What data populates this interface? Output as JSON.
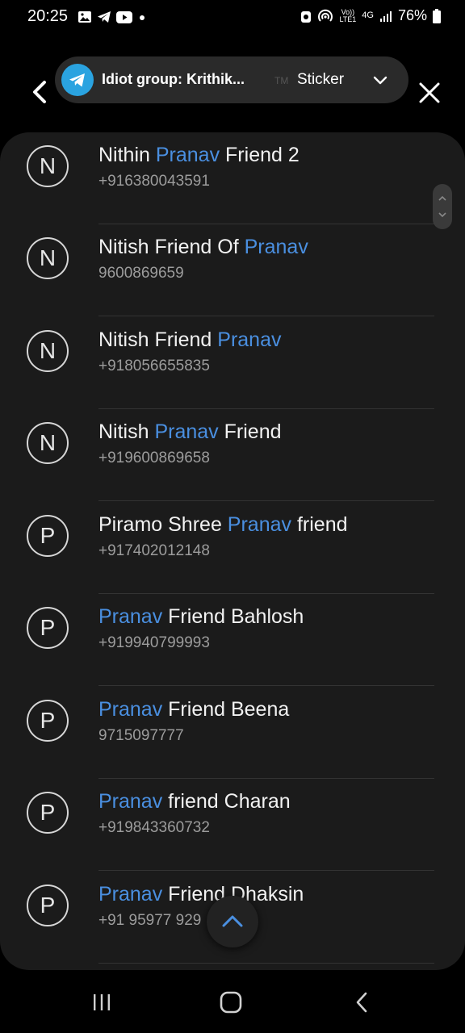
{
  "status_bar": {
    "time": "20:25",
    "battery": "76%",
    "volte": [
      "Vo))",
      "LTE1"
    ],
    "network": "4G",
    "left_icons": [
      "gallery-icon",
      "telegram-icon",
      "youtube-icon",
      "dot-icon"
    ],
    "right_icons": [
      "nfc-icon",
      "hotspot-icon",
      "signal-icon",
      "battery-icon"
    ]
  },
  "header": {
    "chat_title": "Idiot group: Krithik...",
    "tm_label": "TM",
    "sticker_label": "Sticker",
    "accent": "#2aa3e0"
  },
  "contacts": [
    {
      "initial": "N",
      "pre": "Nithin ",
      "hl": "Pranav",
      "post": " Friend 2",
      "phone": "+916380043591"
    },
    {
      "initial": "N",
      "pre": "Nitish Friend Of ",
      "hl": "Pranav",
      "post": "",
      "phone": "9600869659"
    },
    {
      "initial": "N",
      "pre": "Nitish Friend ",
      "hl": "Pranav",
      "post": "",
      "phone": "+918056655835"
    },
    {
      "initial": "N",
      "pre": "Nitish ",
      "hl": "Pranav",
      "post": " Friend",
      "phone": "+919600869658"
    },
    {
      "initial": "P",
      "pre": "Piramo Shree ",
      "hl": "Pranav",
      "post": " friend",
      "phone": "+917402012148"
    },
    {
      "initial": "P",
      "pre": "",
      "hl": "Pranav",
      "post": " Friend Bahlosh",
      "phone": "+919940799993"
    },
    {
      "initial": "P",
      "pre": "",
      "hl": "Pranav",
      "post": " Friend Beena",
      "phone": "9715097777"
    },
    {
      "initial": "P",
      "pre": "",
      "hl": "Pranav",
      "post": " friend Charan",
      "phone": "+919843360732"
    },
    {
      "initial": "P",
      "pre": "",
      "hl": "Pranav",
      "post": " Friend Dhaksin",
      "phone": "+91 95977 929"
    }
  ],
  "colors": {
    "highlight": "#4a8fe0",
    "panel": "#1b1b1b",
    "background": "#000000"
  }
}
